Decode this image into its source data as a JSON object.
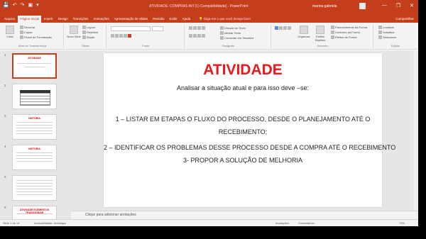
{
  "titlebar": {
    "qat": [
      "💾",
      "↶",
      "↷",
      "▣",
      "▾"
    ],
    "doc_title": "ATIVIDADE- COMPRAS AVI (1) Compatibilidade] - PowerPoint",
    "user": "marina gabriela",
    "controls": [
      "—",
      "❐",
      "✕"
    ]
  },
  "tabs": [
    "Arquivo",
    "Página Inicial",
    "Inserir",
    "Design",
    "Transições",
    "Animações",
    "Apresentação de Slides",
    "Revisão",
    "Exibir",
    "Ajuda"
  ],
  "active_tab": "Página Inicial",
  "tellme": "💡 Diga-me o que você deseja fazer",
  "share": "Compartilhar",
  "ribbon": {
    "clipboard": {
      "paste": "Colar",
      "cut": "Recortar",
      "copy": "Copiar",
      "painter": "Pincel de Formatação",
      "label": "Área de Transferência"
    },
    "slides": {
      "new": "Novo Slide",
      "layout": "Layout",
      "reset": "Redefinir",
      "section": "Seção",
      "label": "Slides"
    },
    "font": {
      "label": "Fonte"
    },
    "paragraph": {
      "label": "Parágrafo",
      "dir": "Direção do Texto",
      "align": "Alinhar Texto",
      "smart": "Converter em SmartArt"
    },
    "drawing": {
      "arrange": "Organizar",
      "styles": "Estilos Rápidos",
      "fill": "Preenchimento da Forma",
      "outline": "Contorno da Forma",
      "effects": "Efeitos de Forma",
      "label": "Desenho"
    },
    "editing": {
      "find": "Localizar",
      "replace": "Substituir",
      "select": "Selecionar",
      "label": "Edição"
    }
  },
  "thumbnails": [
    {
      "num": "1",
      "title": "ATIVIDADE"
    },
    {
      "num": "2",
      "title": ""
    },
    {
      "num": "3",
      "title": "HISTÓRIA"
    },
    {
      "num": "4",
      "title": "HISTÓRIA"
    },
    {
      "num": "5",
      "title": ""
    },
    {
      "num": "6",
      "title": "ATIVIDADE ELEMENTOS TRADICIONAIS"
    }
  ],
  "slide": {
    "title": "ATIVIDADE",
    "subtitle": "Analisar a situação atual e para isso deve –se:",
    "lines": [
      "1 – LISTAR EM ETAPAS O FLUXO DO PROCESSO, DESDE O PLANEJAMENTO ATÉ O",
      "RECEBIMENTO;",
      "2 – IDENTIFICAR OS PROBLEMAS DESSE PROCESSO DESDE A COMPRA ATÉ O RECEBIMENTO",
      "3- PROPOR A SOLUÇÃO DE MELHORIA"
    ]
  },
  "notes_placeholder": "Clique para adicionar anotações",
  "status": {
    "slide_count": "Slide 1 de 14",
    "accessibility": "Acessibilidade: investigar",
    "notes": "Anotações",
    "comments": "Comentários",
    "zoom": "73%"
  }
}
